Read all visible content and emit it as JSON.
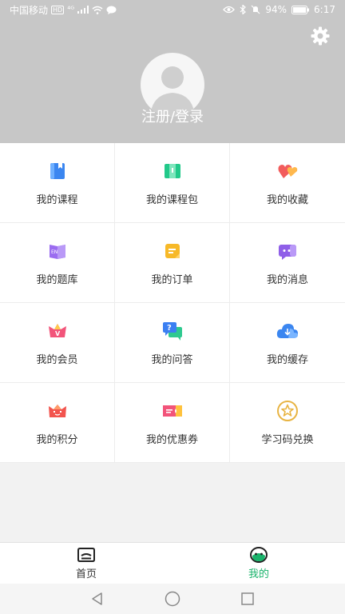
{
  "status_bar": {
    "carrier": "中国移动",
    "hd": "HD",
    "signal": "⁴ᴳ",
    "battery": "94%",
    "time": "6:17"
  },
  "header": {
    "login_label": "注册/登录"
  },
  "menu": [
    {
      "label": "我的课程",
      "icon": "course-icon"
    },
    {
      "label": "我的课程包",
      "icon": "course-pack-icon"
    },
    {
      "label": "我的收藏",
      "icon": "favorites-icon"
    },
    {
      "label": "我的题库",
      "icon": "question-bank-icon"
    },
    {
      "label": "我的订单",
      "icon": "orders-icon"
    },
    {
      "label": "我的消息",
      "icon": "messages-icon"
    },
    {
      "label": "我的会员",
      "icon": "membership-icon"
    },
    {
      "label": "我的问答",
      "icon": "qa-icon"
    },
    {
      "label": "我的缓存",
      "icon": "cache-icon"
    },
    {
      "label": "我的积分",
      "icon": "points-icon"
    },
    {
      "label": "我的优惠券",
      "icon": "coupon-icon"
    },
    {
      "label": "学习码兑换",
      "icon": "redeem-code-icon"
    }
  ],
  "tabbar": {
    "home_label": "首页",
    "mine_label": "我的"
  },
  "colors": {
    "header_bg": "#c7c7c7",
    "accent": "#19b36b"
  }
}
